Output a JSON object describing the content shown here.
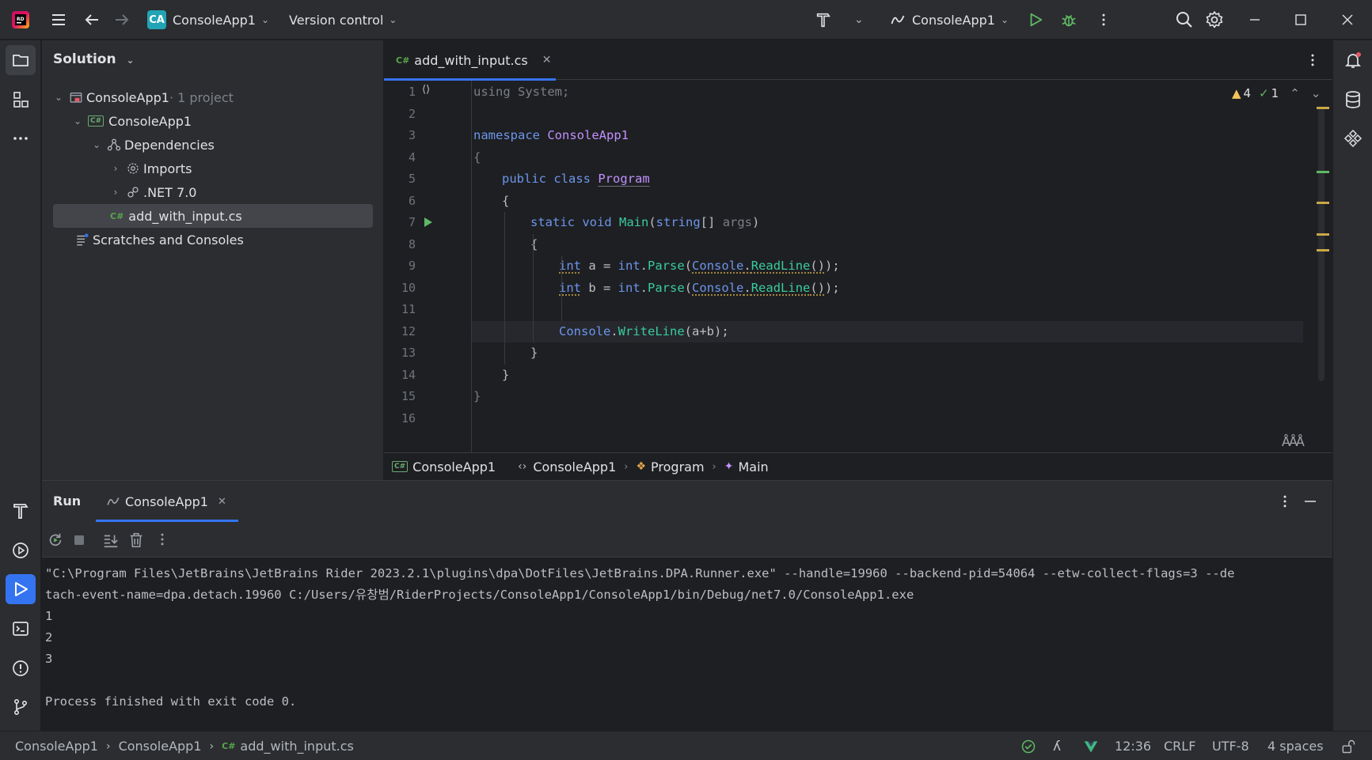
{
  "titlebar": {
    "project_badge": "CA",
    "project_name": "ConsoleApp1",
    "vcs_label": "Version control",
    "run_config": "ConsoleApp1"
  },
  "solution": {
    "title": "Solution",
    "tree": [
      {
        "label": "ConsoleApp1",
        "suffix": " · 1 project"
      },
      {
        "label": "ConsoleApp1"
      },
      {
        "label": "Dependencies"
      },
      {
        "label": "Imports"
      },
      {
        "label": ".NET 7.0"
      },
      {
        "label": "add_with_input.cs"
      },
      {
        "label": "Scratches and Consoles"
      }
    ]
  },
  "editor": {
    "tab_label": "add_with_input.cs",
    "tab_lang": "C#",
    "warnings": "4",
    "checks": "1",
    "line_numbers": [
      "1",
      "2",
      "3",
      "4",
      "5",
      "6",
      "7",
      "8",
      "9",
      "10",
      "11",
      "12",
      "13",
      "14",
      "15",
      "16"
    ],
    "code": {
      "l1": "using System;",
      "l3_kw": "namespace",
      "l3_name": "ConsoleApp1",
      "l4": "{",
      "l5_kw": "public class",
      "l5_name": "Program",
      "l6": "{",
      "l7_kw": "static void",
      "l7_meth": "Main",
      "l7_open": "(",
      "l7_type": "string",
      "l7_arr": "[]",
      "l7_arg": "args",
      "l7_close": ")",
      "l8": "{",
      "l9_type": "int",
      "l9_rest": " a = ",
      "l10_type": "int",
      "l10_rest": " b = ",
      "parse_kw": "int",
      "parse_dot": ".",
      "parse_meth": "Parse",
      "console_cls": "Console",
      "readline": "ReadLine",
      "l12_cls": "Console",
      "l12_meth": "WriteLine",
      "l12_args": "(a+b);",
      "l13": "}",
      "l14": "}",
      "l15": "}"
    },
    "breadcrumb": [
      "ConsoleApp1",
      "ConsoleApp1",
      "Program",
      "Main"
    ]
  },
  "run": {
    "tab_run": "Run",
    "tab_config": "ConsoleApp1",
    "output": [
      "\"C:\\Program Files\\JetBrains\\JetBrains Rider 2023.2.1\\plugins\\dpa\\DotFiles\\JetBrains.DPA.Runner.exe\" --handle=19960 --backend-pid=54064 --etw-collect-flags=3 --de",
      "tach-event-name=dpa.detach.19960 C:/Users/유창범/RiderProjects/ConsoleApp1/ConsoleApp1/bin/Debug/net7.0/ConsoleApp1.exe",
      "1",
      "2",
      "3",
      "",
      "Process finished with exit code 0."
    ]
  },
  "statusbar": {
    "path": [
      "ConsoleApp1",
      "ConsoleApp1",
      "add_with_input.cs"
    ],
    "file_lang": "C#",
    "position": "12:36",
    "line_ending": "CRLF",
    "encoding": "UTF-8",
    "indent": "4 spaces"
  }
}
